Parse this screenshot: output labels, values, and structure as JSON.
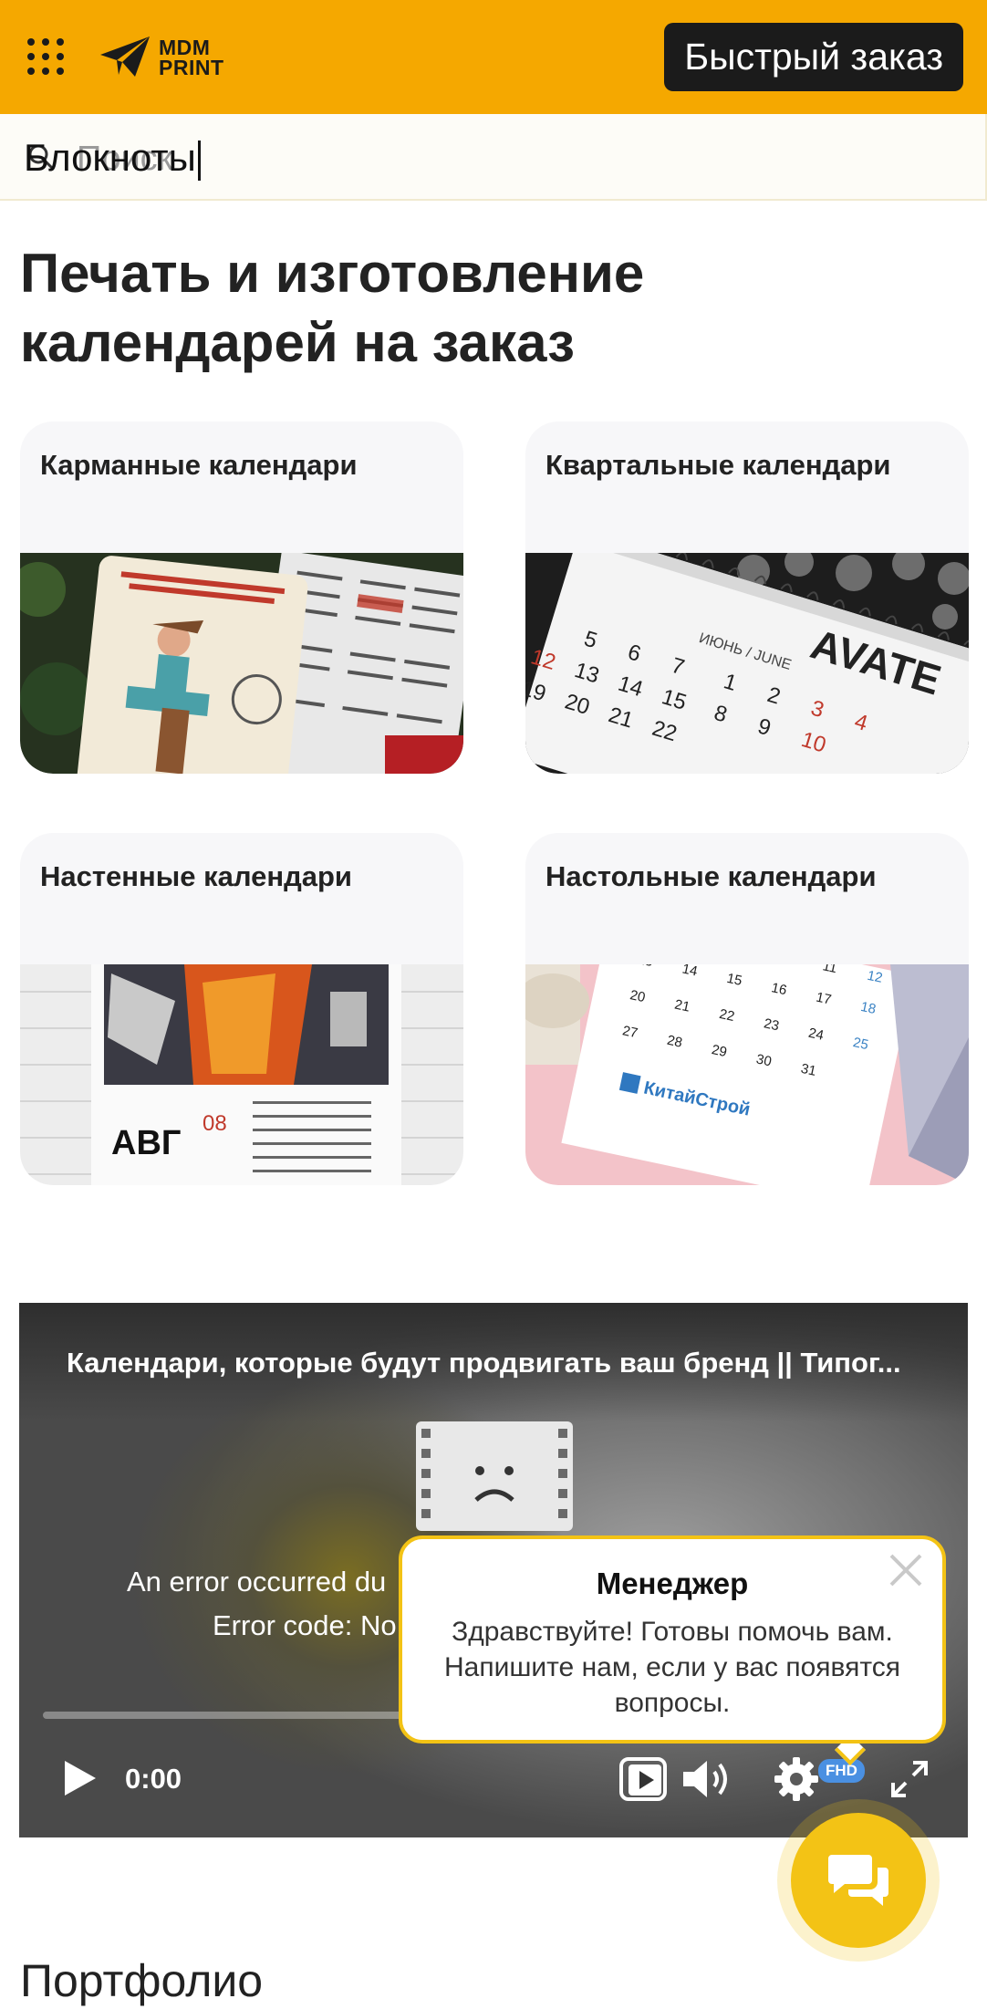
{
  "header": {
    "logo_line1": "MDM",
    "logo_line2": "PRINT",
    "quick_order_label": "Быстрый заказ",
    "accent_color": "#f5a800"
  },
  "search": {
    "placeholder": "Поиск",
    "typed_value": "Блокноты"
  },
  "page": {
    "title": "Печать и изготовление календарей на заказ"
  },
  "categories": [
    {
      "label": "Карманные календари"
    },
    {
      "label": "Квартальные календари"
    },
    {
      "label": "Настенные календари"
    },
    {
      "label": "Настольные календари"
    }
  ],
  "video": {
    "title": "Календари, которые будут продвигать ваш бренд || Типог...",
    "error_line1": "An error occurred du",
    "error_line2": "Error code: No",
    "time": "0:00",
    "quality_badge": "FHD",
    "progress_fraction": 0
  },
  "popup": {
    "title": "Менеджер",
    "text": "Здравствуйте! Готовы помочь вам. Напишите нам, если у вас появятся вопросы.",
    "border_color": "#f3c315"
  },
  "portfolio": {
    "title": "Портфолио"
  }
}
